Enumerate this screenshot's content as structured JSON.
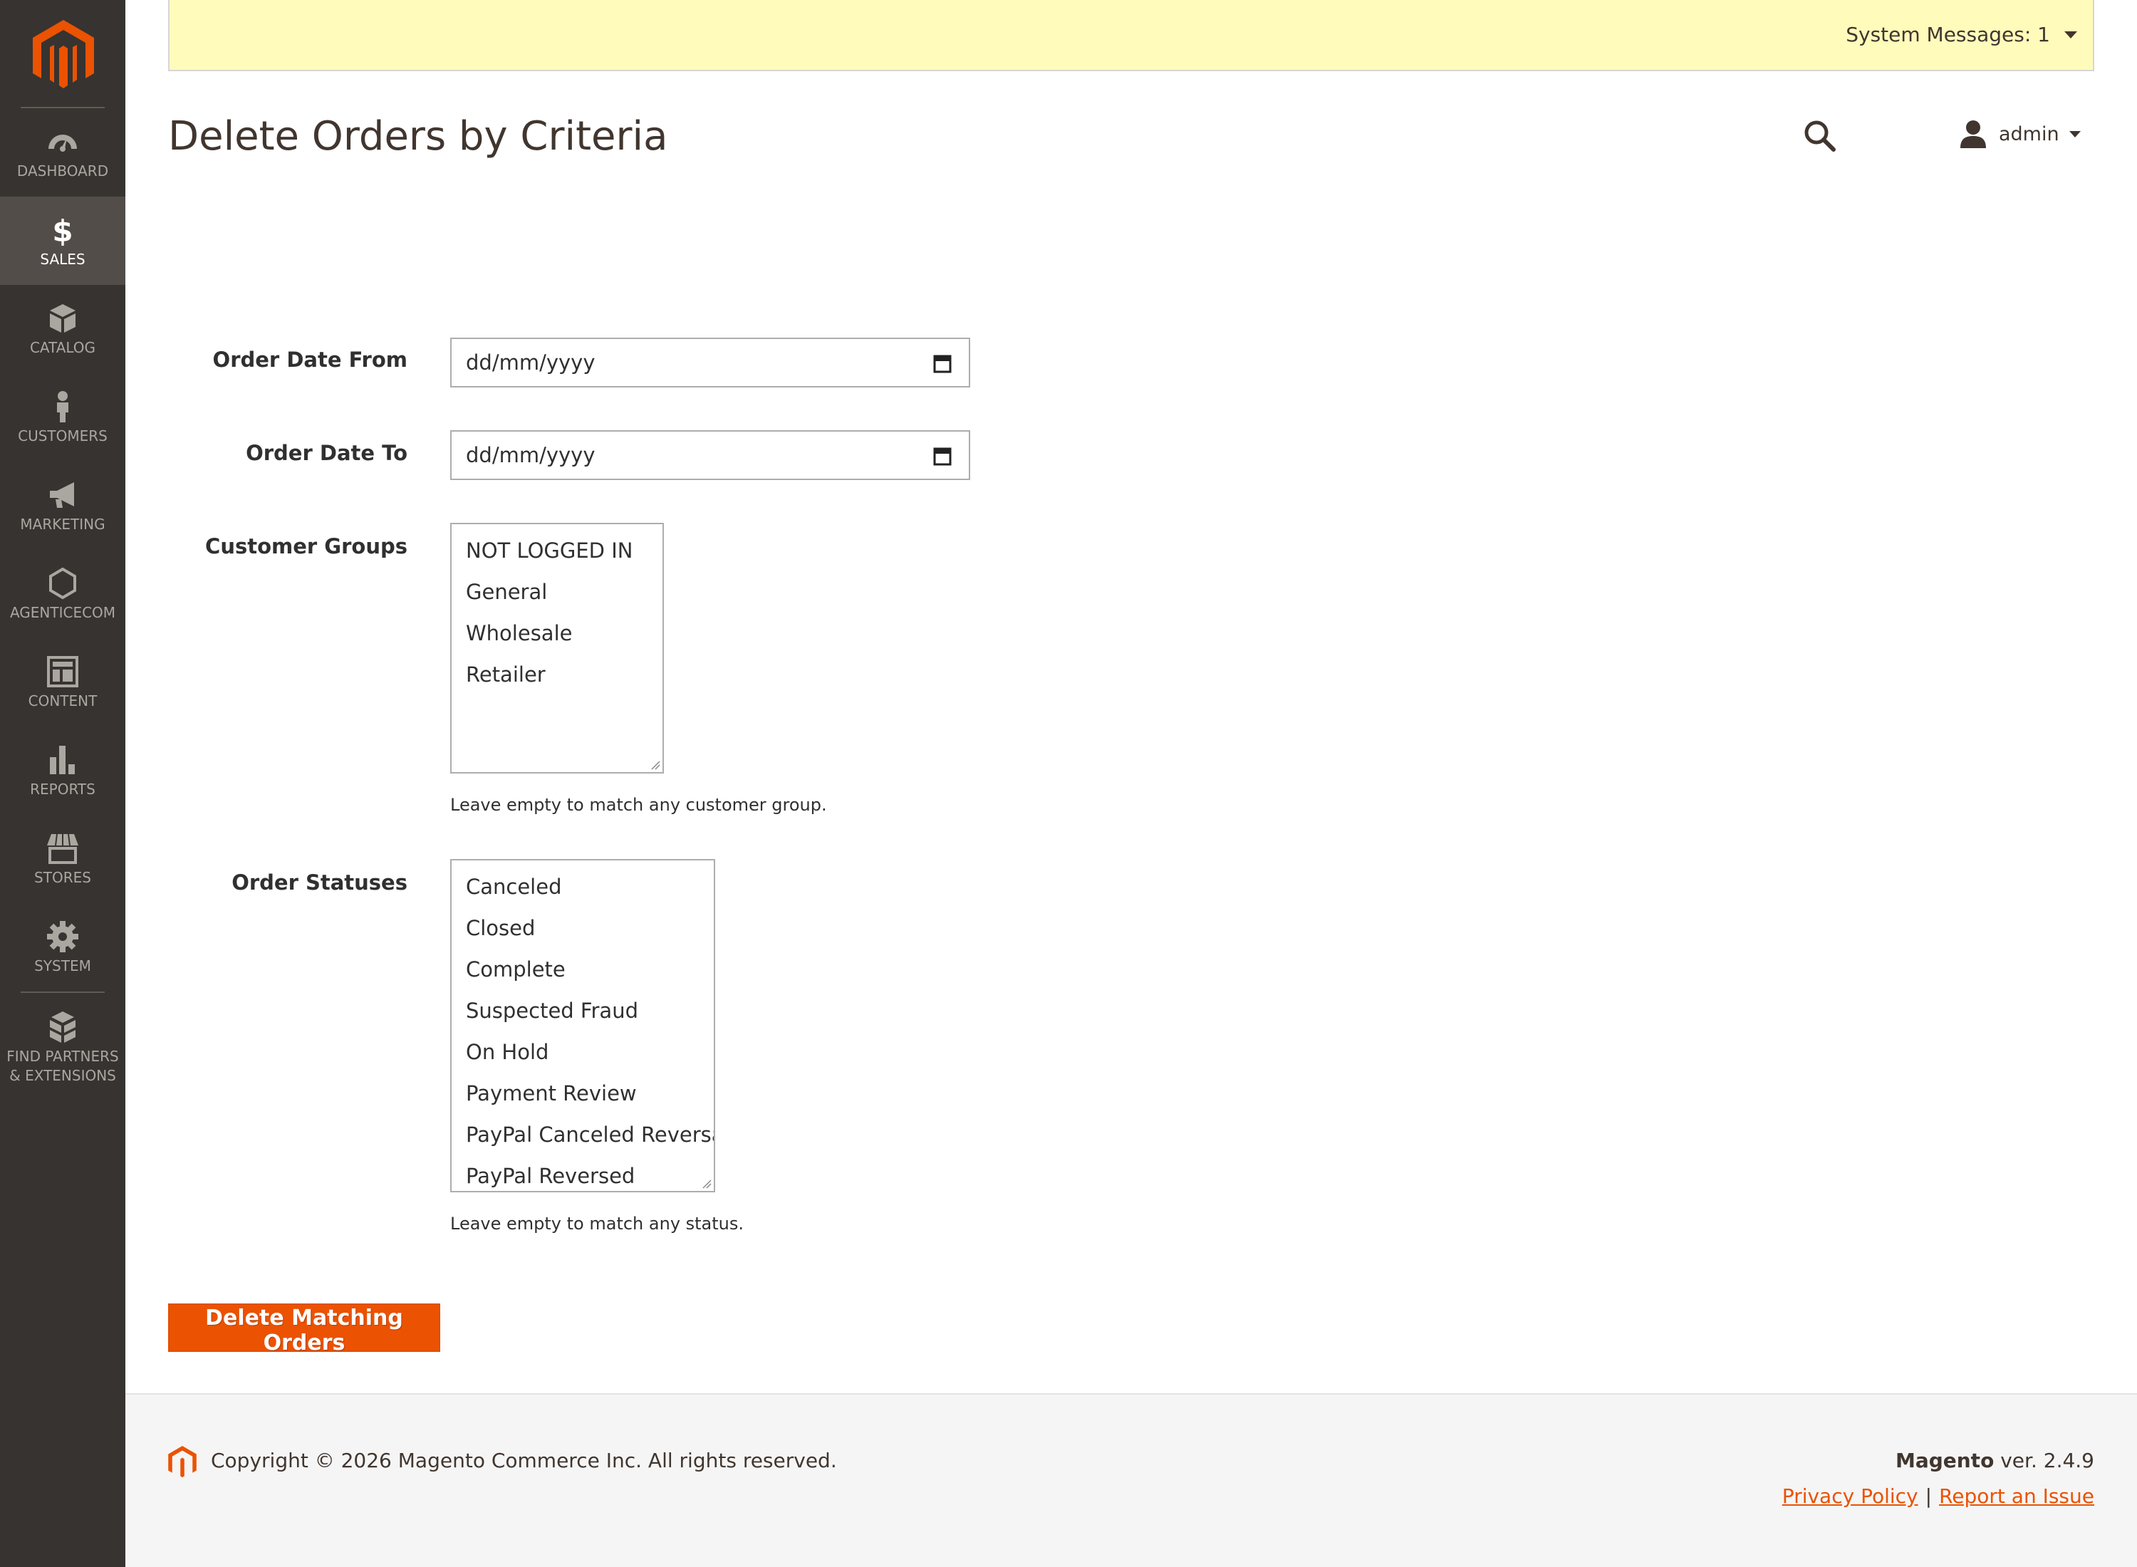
{
  "sidebar": {
    "items": [
      {
        "label": "Dashboard",
        "icon": "dashboard-icon"
      },
      {
        "label": "Sales",
        "icon": "dollar-icon",
        "active": true
      },
      {
        "label": "Catalog",
        "icon": "cube-icon"
      },
      {
        "label": "Customers",
        "icon": "person-icon"
      },
      {
        "label": "Marketing",
        "icon": "megaphone-icon"
      },
      {
        "label": "AgenticEcom",
        "icon": "hexagon-icon"
      },
      {
        "label": "Content",
        "icon": "layout-icon"
      },
      {
        "label": "Reports",
        "icon": "bar-chart-icon"
      },
      {
        "label": "Stores",
        "icon": "storefront-icon"
      },
      {
        "label": "System",
        "icon": "gear-icon"
      },
      {
        "label": "Find Partners\n& Extensions",
        "icon": "boxes-icon"
      }
    ]
  },
  "header": {
    "system_messages": "System Messages: 1",
    "page_title": "Delete Orders by Criteria",
    "user": "admin"
  },
  "form": {
    "order_date_from": {
      "label": "Order Date From",
      "placeholder": "dd/mm/yyyy"
    },
    "order_date_to": {
      "label": "Order Date To",
      "placeholder": "dd/mm/yyyy"
    },
    "customer_groups": {
      "label": "Customer Groups",
      "options": [
        "NOT LOGGED IN",
        "General",
        "Wholesale",
        "Retailer"
      ],
      "note": "Leave empty to match any customer group."
    },
    "order_statuses": {
      "label": "Order Statuses",
      "options": [
        "Canceled",
        "Closed",
        "Complete",
        "Suspected Fraud",
        "On Hold",
        "Payment Review",
        "PayPal Canceled Reversal",
        "PayPal Reversed"
      ],
      "note": "Leave empty to match any status."
    },
    "submit_label": "Delete Matching Orders"
  },
  "footer": {
    "copyright": "Copyright © 2026 Magento Commerce Inc. All rights reserved.",
    "brand": "Magento",
    "version": " ver. 2.4.9",
    "privacy": "Privacy Policy",
    "separator": "|",
    "report": "Report an Issue"
  },
  "colors": {
    "sidebar_bg": "#373330",
    "active_item_bg": "#524d49",
    "accent": "#eb5202",
    "message_bar": "#fffbbb"
  }
}
